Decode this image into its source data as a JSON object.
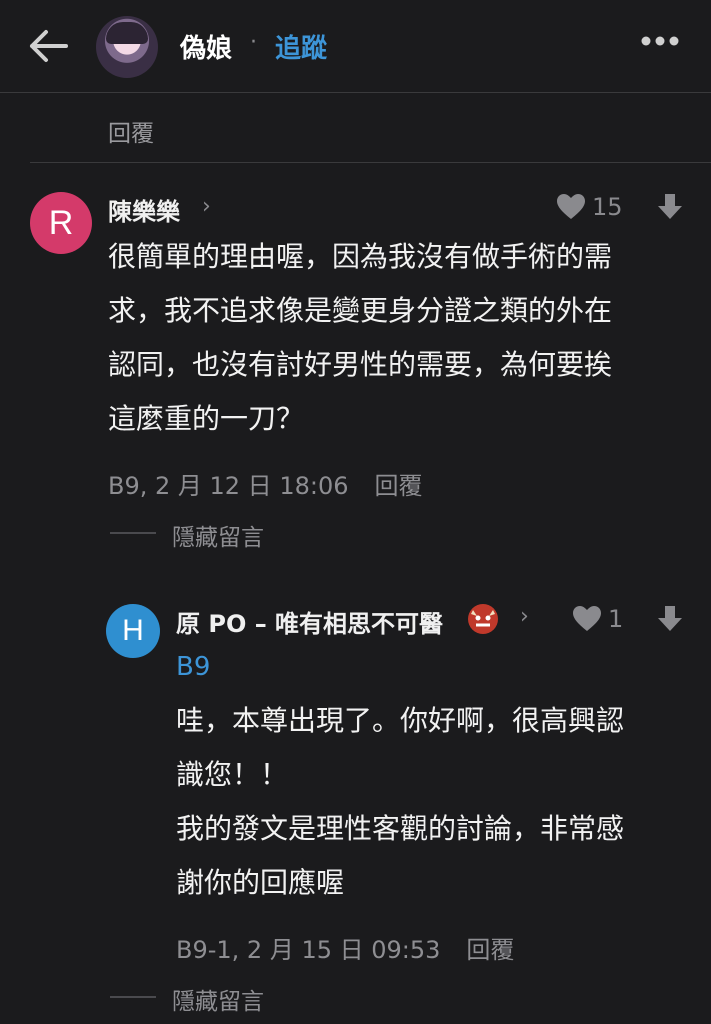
{
  "header": {
    "author": "偽娘",
    "separator": "·",
    "follow_label": "追蹤"
  },
  "reply_top_label": "回覆",
  "comment": {
    "avatar_letter": "R",
    "avatar_color": "#d43a6a",
    "name": "陳樂樂",
    "likes": "15",
    "lines": [
      "很簡單的理由喔，因為我沒有做手術的需",
      "求，我不追求像是變更身分證之類的外在",
      "認同，也沒有討好男性的需要，為何要挨",
      "這麼重的一刀？"
    ],
    "meta": "B9, 2 月 12 日 18:06",
    "reply_label": "回覆",
    "hide_label": "隱藏留言"
  },
  "reply": {
    "avatar_letter": "H",
    "avatar_color": "#2f8fd0",
    "name": "原 PO – 唯有相思不可醫",
    "likes": "1",
    "tag": "B9",
    "lines": [
      "哇，本尊出現了。你好啊，很高興認",
      "識您！！",
      "我的發文是理性客觀的討論，非常感",
      "謝你的回應喔"
    ],
    "meta": "B9-1, 2 月 15 日 09:53",
    "reply_label": "回覆",
    "hide_label": "隱藏留言"
  }
}
